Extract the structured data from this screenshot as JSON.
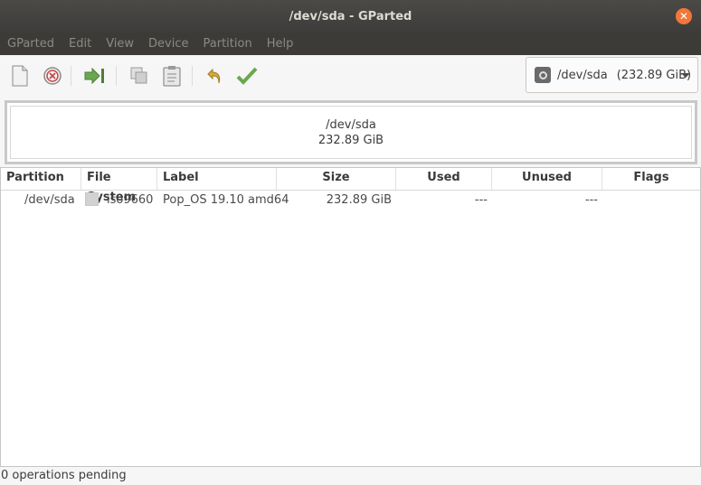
{
  "window": {
    "title": "/dev/sda - GParted"
  },
  "menubar": {
    "items": [
      "GParted",
      "Edit",
      "View",
      "Device",
      "Partition",
      "Help"
    ]
  },
  "toolbar": {
    "buttons": [
      {
        "icon": "new-icon"
      },
      {
        "icon": "delete-icon"
      },
      {
        "icon": "resize-move-icon"
      },
      {
        "icon": "copy-icon"
      },
      {
        "icon": "paste-icon"
      },
      {
        "icon": "undo-icon"
      },
      {
        "icon": "apply-icon"
      }
    ]
  },
  "device_selector": {
    "device": "/dev/sda",
    "size": "(232.89 GiB)"
  },
  "disk_map": {
    "name": "/dev/sda",
    "size": "232.89 GiB"
  },
  "table": {
    "columns": [
      "Partition",
      "File System",
      "Label",
      "Size",
      "Used",
      "Unused",
      "Flags"
    ],
    "rows": [
      {
        "partition": "/dev/sda",
        "filesystem": "iso9660",
        "filesystem_color": "#d2d2d2",
        "label": "Pop_OS 19.10 amd64",
        "size": "232.89 GiB",
        "used": "---",
        "unused": "---",
        "flags": ""
      }
    ]
  },
  "status": {
    "text": "0 operations pending"
  },
  "colors": {
    "titlebar": "#3d3c3a",
    "close": "#f1773a",
    "menubar": "#3c3b37"
  }
}
